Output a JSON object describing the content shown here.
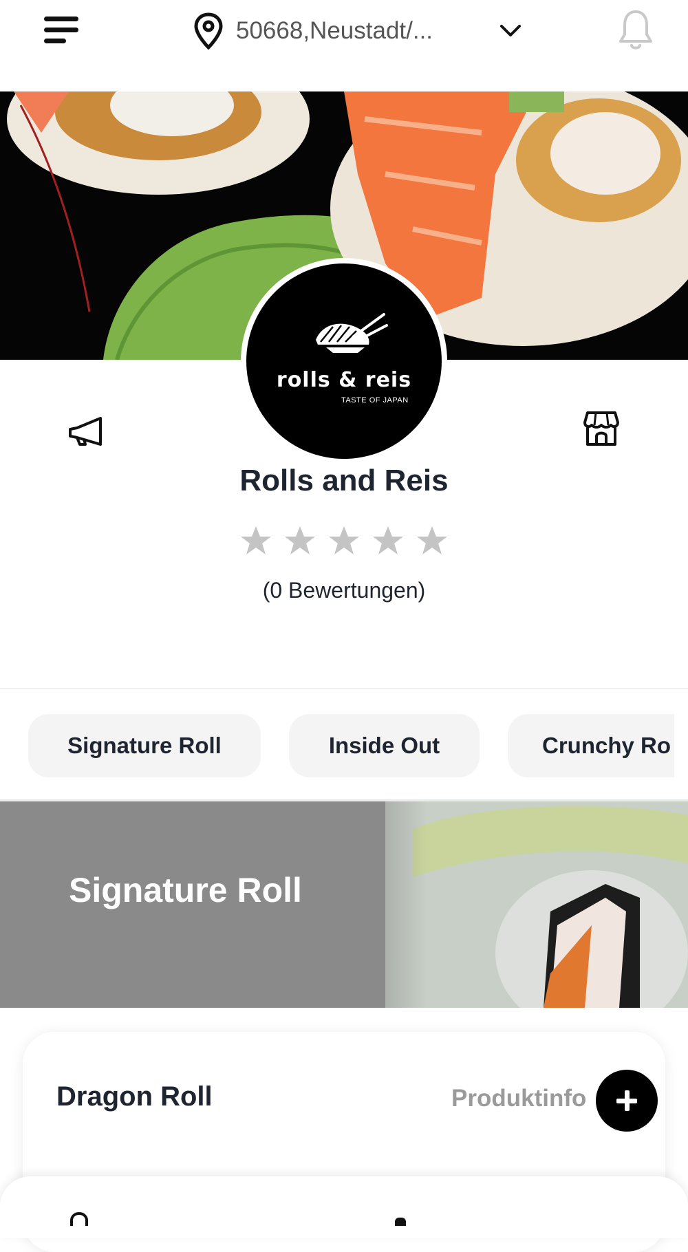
{
  "header": {
    "location": "50668,Neustadt/...",
    "icons": [
      "menu-icon",
      "location-pin-icon",
      "chevron-down-icon",
      "bell-icon"
    ]
  },
  "restaurant": {
    "logo_name": "rolls & reis",
    "logo_tagline": "TASTE OF JAPAN",
    "name": "Rolls and Reis",
    "rating_stars": 0,
    "rating_max": 5,
    "reviews_label": "(0 Bewertungen)",
    "icons": [
      "megaphone-icon",
      "store-icon"
    ]
  },
  "category_tabs": [
    {
      "label": "Signature Roll"
    },
    {
      "label": "Inside Out"
    },
    {
      "label": "Crunchy Ro"
    }
  ],
  "category_section": {
    "title": "Signature Roll"
  },
  "products": [
    {
      "name": "Dragon Roll",
      "info_label": "Produktinfo"
    }
  ],
  "colors": {
    "text_dark": "#1f2530",
    "star_empty": "#c4c4c4",
    "tab_bg": "#f4f4f4",
    "button_black": "#000000"
  }
}
